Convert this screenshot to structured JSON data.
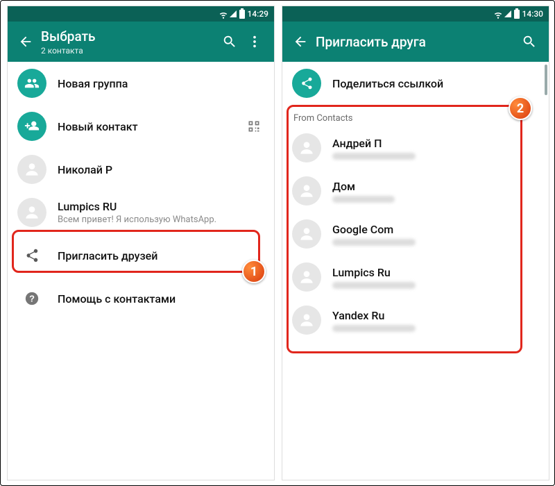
{
  "left": {
    "status_time": "14:29",
    "title": "Выбрать",
    "subtitle": "2 контакта",
    "rows": {
      "new_group": "Новая группа",
      "new_contact": "Новый контакт",
      "contact1": "Николай Р",
      "contact2": "Lumpics RU",
      "contact2_sub": "Всем привет! Я использую WhatsApp.",
      "invite": "Пригласить друзей",
      "help": "Помощь с контактами"
    },
    "badge": "1"
  },
  "right": {
    "status_time": "14:30",
    "title": "Пригласить друга",
    "share_link": "Поделиться ссылкой",
    "section": "From Contacts",
    "contacts": [
      "Андрей П",
      "Дом",
      "Google Com",
      "Lumpics Ru",
      "Yandex Ru"
    ],
    "badge": "2"
  }
}
